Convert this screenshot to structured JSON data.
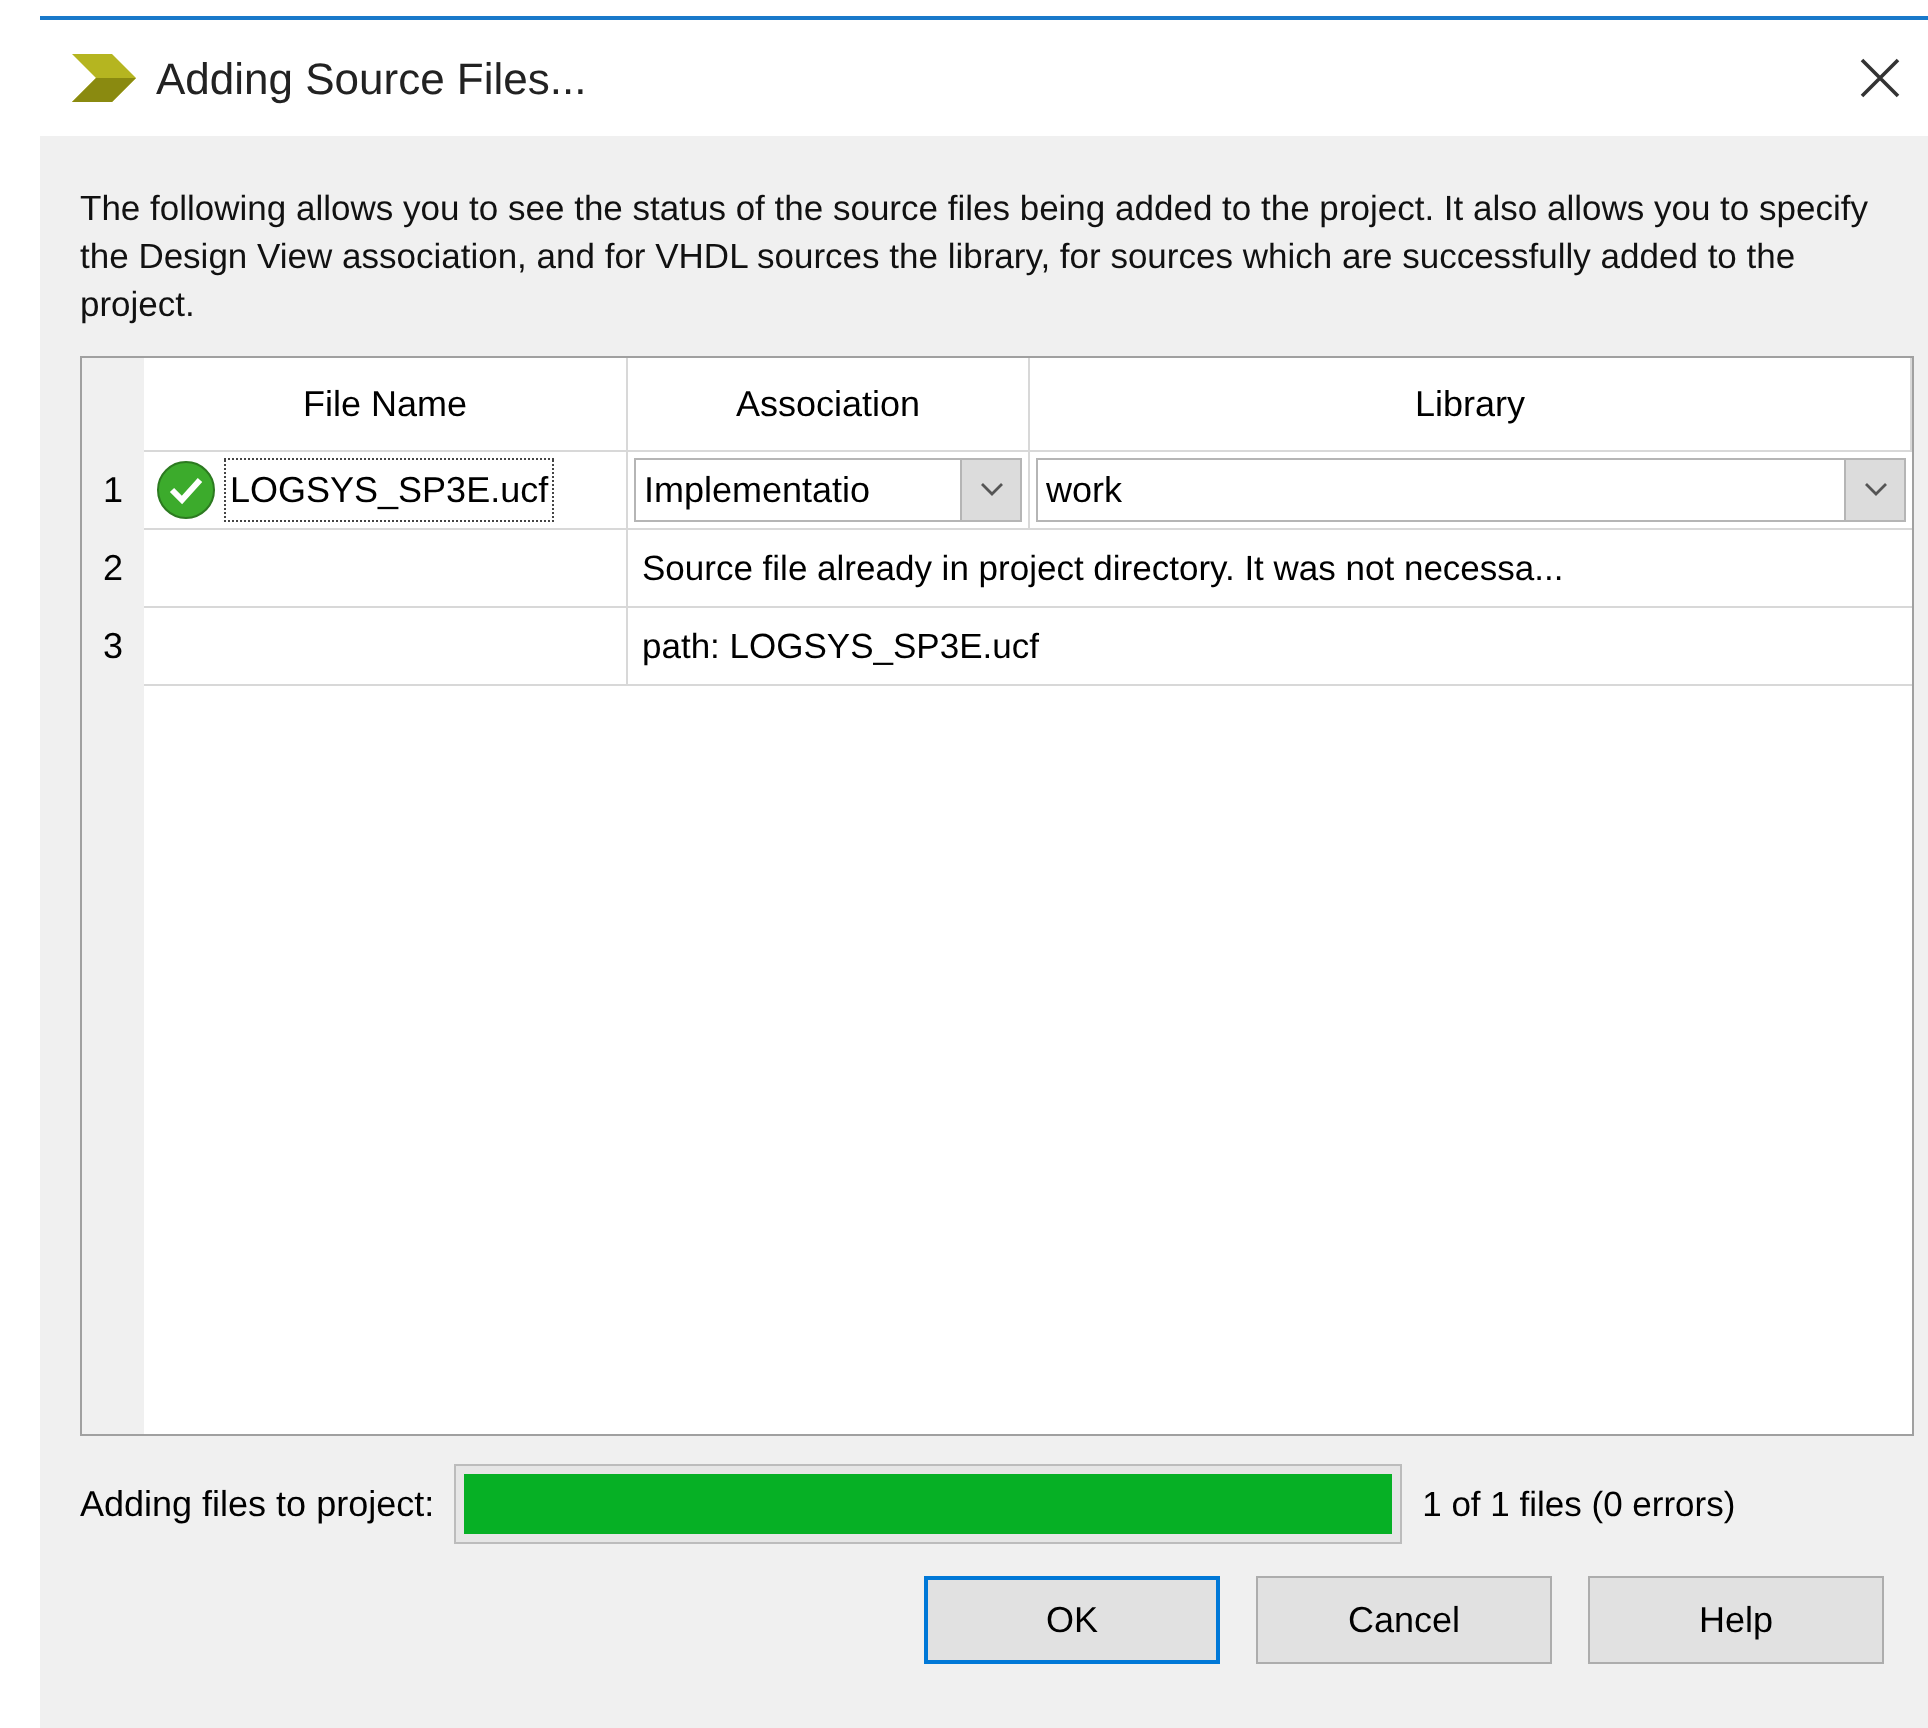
{
  "window": {
    "title": "Adding Source Files..."
  },
  "description": "The following allows you to see the status of the source files being added to the project.  It also allows you to specify the Design View association, and for VHDL sources the library, for sources which are successfully added to the project.",
  "table": {
    "columns": [
      "File Name",
      "Association",
      "Library"
    ],
    "rows": [
      {
        "kind": "file",
        "number": "1",
        "added": true,
        "file_name": "LOGSYS_SP3E.ucf",
        "association": "Implementatio",
        "library": "work"
      },
      {
        "kind": "message",
        "number": "2",
        "message": "Source file already in project directory. It was not necessa..."
      },
      {
        "kind": "message",
        "number": "3",
        "message": "path: LOGSYS_SP3E.ucf"
      }
    ]
  },
  "progress": {
    "label": "Adding files to project:",
    "level": 1,
    "reading": "1 of 1 files (0 errors)"
  },
  "buttons": [
    {
      "label": "OK",
      "default": true
    },
    {
      "label": "Cancel",
      "default": false
    },
    {
      "label": "Help",
      "default": false
    }
  ]
}
